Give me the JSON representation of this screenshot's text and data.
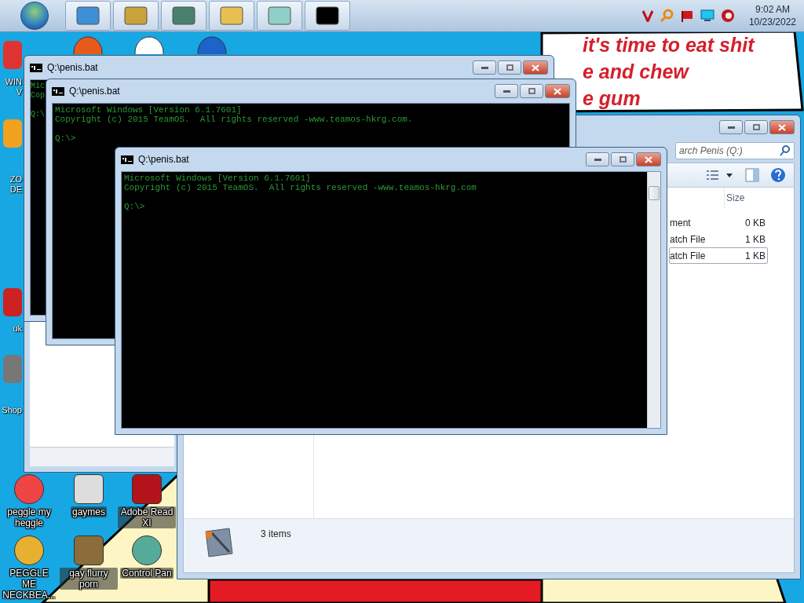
{
  "taskbar": {
    "clock": {
      "time": "9:02 AM",
      "date": "10/23/2022"
    }
  },
  "wallpaper_text": [
    "it's time to eat shit",
    "e and chew",
    "e gum"
  ],
  "desktop_icons": [
    {
      "label": "WIN V"
    },
    {
      "label": "ZO DE"
    },
    {
      "label": "uk"
    },
    {
      "label": "Shop"
    },
    {
      "label": "peggle my heggle"
    },
    {
      "label": "PEGGLE ME NECKBEA..."
    },
    {
      "label": "gaymes"
    },
    {
      "label": "gay flurry porn"
    },
    {
      "label": "Adobe Read XI"
    },
    {
      "label": "Control Pan"
    }
  ],
  "explorer": {
    "search": {
      "placeholder": "arch Penis (Q:)"
    },
    "columns": [
      "Size"
    ],
    "rows": [
      {
        "name": "ment",
        "size": "0 KB",
        "selected": false
      },
      {
        "name": "atch File",
        "size": "1 KB",
        "selected": false
      },
      {
        "name": "atch File",
        "size": "1 KB",
        "selected": true
      }
    ],
    "status_bar": "3 items"
  },
  "console_windows": [
    {
      "title": "Q:\\penis.bat",
      "lines": [
        "Mic",
        "Cop"
      ],
      "prompt": "Q:\\"
    },
    {
      "title": "Q:\\penis.bat",
      "lines": [
        "Microsoft Windows [Version 6.1.7601]",
        "Copyright (c) 2015 TeamOS.  All rights reserved -www.teamos-hkrg.com."
      ],
      "prompt": "Q:\\>"
    },
    {
      "title": "Q:\\penis.bat",
      "lines": [
        "Microsoft Windows [Version 6.1.7601]",
        "Copyright (c) 2015 TeamOS.  All rights reserved -www.teamos-hkrg.com"
      ],
      "prompt": "Q:\\>"
    }
  ]
}
